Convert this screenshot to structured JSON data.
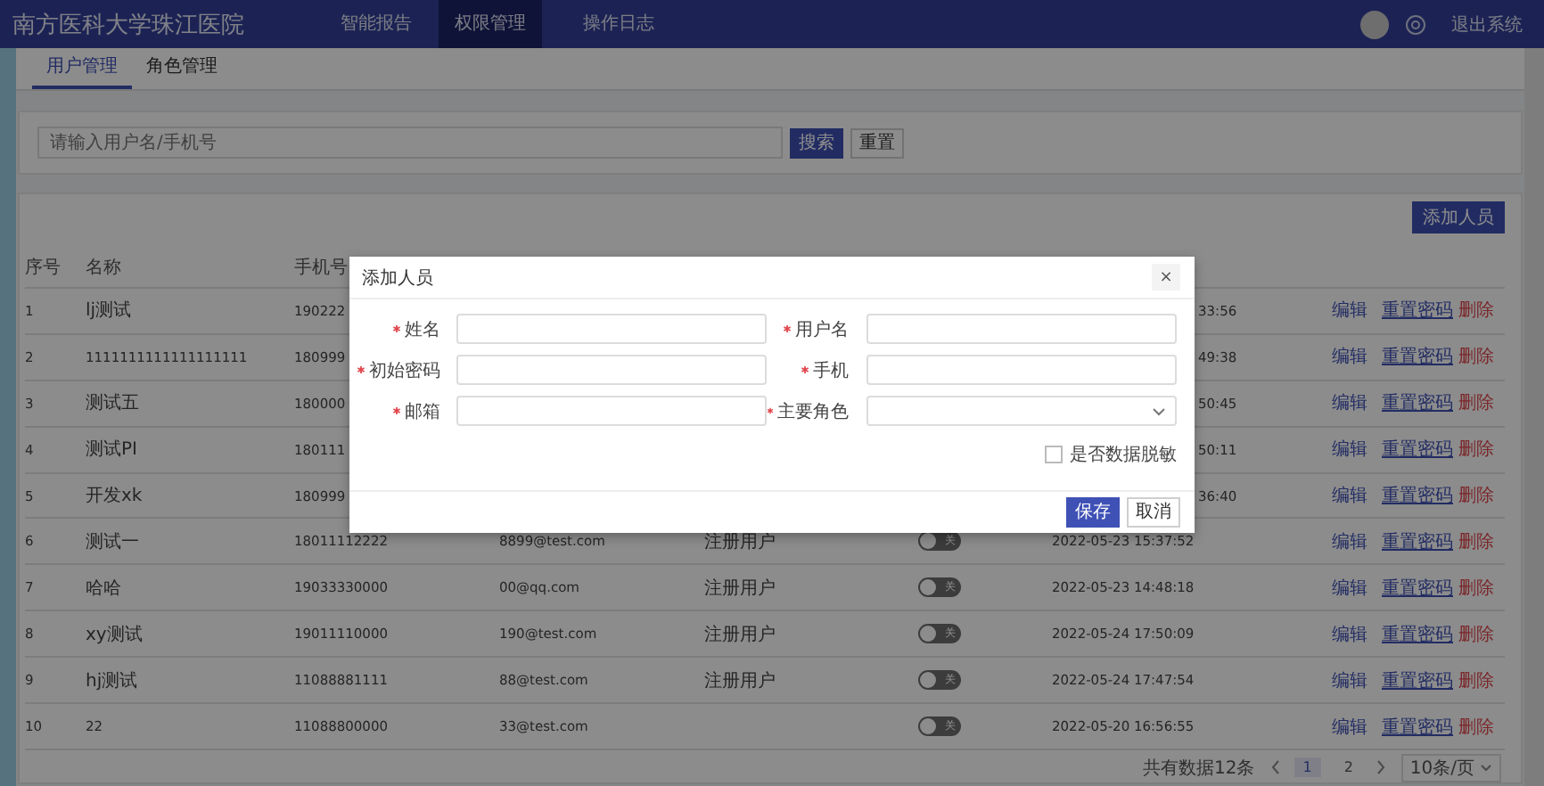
{
  "app": {
    "title": "南方医科大学珠江医院",
    "nav": [
      {
        "label": "智能报告",
        "selected": false
      },
      {
        "label": "权限管理",
        "selected": true
      },
      {
        "label": "操作日志",
        "selected": false
      }
    ],
    "logout": "退出系统"
  },
  "tabs": [
    {
      "label": "用户管理",
      "selected": true
    },
    {
      "label": "角色管理",
      "selected": false
    }
  ],
  "search": {
    "placeholder": "请输入用户名/手机号",
    "buttons": [
      {
        "label": "搜索",
        "kind": "primary"
      },
      {
        "label": "重置",
        "kind": "default"
      }
    ]
  },
  "add_button": "添加人员",
  "table": {
    "columns": [
      "序号",
      "名称",
      "手机号"
    ],
    "rows": [
      {
        "kind": "covered",
        "index": "1",
        "name": "lj测试",
        "phone": "190222",
        "created": "33:56",
        "actions": [
          {
            "label": "编辑",
            "kind": "edit"
          },
          {
            "label": "重置密码",
            "kind": "reset"
          },
          {
            "label": "删除",
            "kind": "delete"
          }
        ]
      },
      {
        "kind": "covered",
        "index": "2",
        "name": "1111111111111111111",
        "phone": "180999",
        "created": "49:38",
        "actions": [
          {
            "label": "编辑",
            "kind": "edit"
          },
          {
            "label": "重置密码",
            "kind": "reset"
          },
          {
            "label": "删除",
            "kind": "delete"
          }
        ]
      },
      {
        "kind": "covered",
        "index": "3",
        "name": "测试五",
        "phone": "180000",
        "created": "50:45",
        "actions": [
          {
            "label": "编辑",
            "kind": "edit"
          },
          {
            "label": "重置密码",
            "kind": "reset"
          },
          {
            "label": "删除",
            "kind": "delete"
          }
        ]
      },
      {
        "kind": "covered",
        "index": "4",
        "name": "测试PI",
        "phone": "180111",
        "created": "50:11",
        "actions": [
          {
            "label": "编辑",
            "kind": "edit"
          },
          {
            "label": "重置密码",
            "kind": "reset"
          },
          {
            "label": "删除",
            "kind": "delete"
          }
        ]
      },
      {
        "kind": "covered",
        "index": "5",
        "name": "开发xk",
        "phone": "180999",
        "created": "36:40",
        "actions": [
          {
            "label": "编辑",
            "kind": "edit"
          },
          {
            "label": "重置密码",
            "kind": "reset"
          },
          {
            "label": "删除",
            "kind": "delete"
          }
        ]
      },
      {
        "kind": "full",
        "index": "6",
        "name": "测试一",
        "phone": "18011112222",
        "email": "8899@test.com",
        "role": "注册用户",
        "switch": {
          "label": "关",
          "on": false
        },
        "created": "2022-05-23 15:37:52",
        "actions": [
          {
            "label": "编辑",
            "kind": "edit"
          },
          {
            "label": "重置密码",
            "kind": "reset"
          },
          {
            "label": "删除",
            "kind": "delete"
          }
        ]
      },
      {
        "kind": "full",
        "index": "7",
        "name": "哈哈",
        "phone": "19033330000",
        "email": "00@qq.com",
        "role": "注册用户",
        "switch": {
          "label": "关",
          "on": false
        },
        "created": "2022-05-23 14:48:18",
        "actions": [
          {
            "label": "编辑",
            "kind": "edit"
          },
          {
            "label": "重置密码",
            "kind": "reset"
          },
          {
            "label": "删除",
            "kind": "delete"
          }
        ]
      },
      {
        "kind": "full",
        "index": "8",
        "name": "xy测试",
        "phone": "19011110000",
        "email": "190@test.com",
        "role": "注册用户",
        "switch": {
          "label": "关",
          "on": false
        },
        "created": "2022-05-24 17:50:09",
        "actions": [
          {
            "label": "编辑",
            "kind": "edit"
          },
          {
            "label": "重置密码",
            "kind": "reset"
          },
          {
            "label": "删除",
            "kind": "delete"
          }
        ]
      },
      {
        "kind": "full",
        "index": "9",
        "name": "hj测试",
        "phone": "11088881111",
        "email": "88@test.com",
        "role": "注册用户",
        "switch": {
          "label": "关",
          "on": false
        },
        "created": "2022-05-24 17:47:54",
        "actions": [
          {
            "label": "编辑",
            "kind": "edit"
          },
          {
            "label": "重置密码",
            "kind": "reset"
          },
          {
            "label": "删除",
            "kind": "delete"
          }
        ]
      },
      {
        "kind": "full",
        "index": "10",
        "name": "22",
        "phone": "11088800000",
        "email": "33@test.com",
        "switch": {
          "label": "关",
          "on": false
        },
        "created": "2022-05-20 16:56:55",
        "actions": [
          {
            "label": "编辑",
            "kind": "edit"
          },
          {
            "label": "重置密码",
            "kind": "reset"
          },
          {
            "label": "删除",
            "kind": "delete"
          }
        ]
      }
    ]
  },
  "pagination": {
    "total": "共有数据12条",
    "pages": [
      {
        "label": "1",
        "selected": true
      },
      {
        "label": "2",
        "selected": false
      }
    ],
    "page_size": "10条/页"
  },
  "dialog": {
    "title": "添加人员",
    "close": "×",
    "fields": [
      {
        "label": "姓名",
        "required": true,
        "kind": "text"
      },
      {
        "label": "用户名",
        "required": true,
        "kind": "text"
      },
      {
        "label": "初始密码",
        "required": true,
        "kind": "text"
      },
      {
        "label": "手机",
        "required": true,
        "kind": "text"
      },
      {
        "label": "邮箱",
        "required": true,
        "kind": "text"
      },
      {
        "label": "主要角色",
        "required": true,
        "kind": "select"
      }
    ],
    "checkbox": {
      "label": "是否数据脱敏",
      "checked": false
    },
    "buttons": [
      {
        "label": "保存",
        "kind": "primary"
      },
      {
        "label": "取消",
        "kind": "default"
      }
    ]
  }
}
